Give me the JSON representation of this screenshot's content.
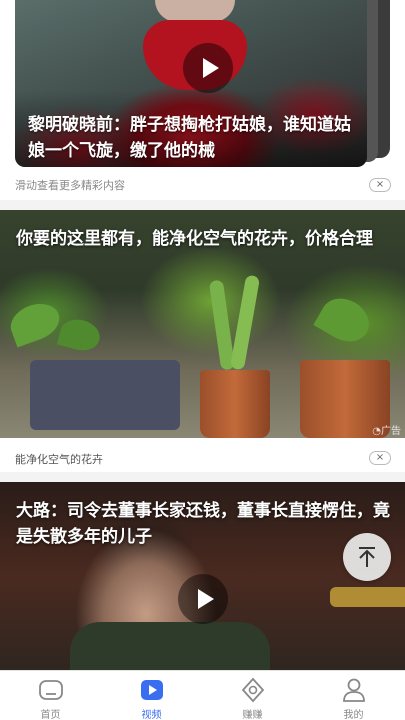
{
  "feed": {
    "card1": {
      "title": "黎明破晓前：胖子想掏枪打姑娘，谁知道姑娘一个飞旋，缴了他的械",
      "hint": "滑动查看更多精彩内容"
    },
    "card2": {
      "title": "你要的这里都有，能净化空气的花卉，价格合理",
      "ad_badge": "广告",
      "caption": "能净化空气的花卉"
    },
    "card3": {
      "title": "大路：司令去董事长家还钱，董事长直接愣住，竟是失散多年的儿子"
    }
  },
  "bottom_nav": {
    "items": [
      {
        "label": "首页",
        "icon": "home-icon",
        "active": false
      },
      {
        "label": "视频",
        "icon": "video-play-icon",
        "active": true
      },
      {
        "label": "赚赚",
        "icon": "earn-coin-icon",
        "active": false
      },
      {
        "label": "我的",
        "icon": "profile-icon",
        "active": false
      }
    ]
  },
  "colors": {
    "accent": "#3b6df0",
    "inactive": "#888888",
    "background": "#f3f3f3"
  }
}
